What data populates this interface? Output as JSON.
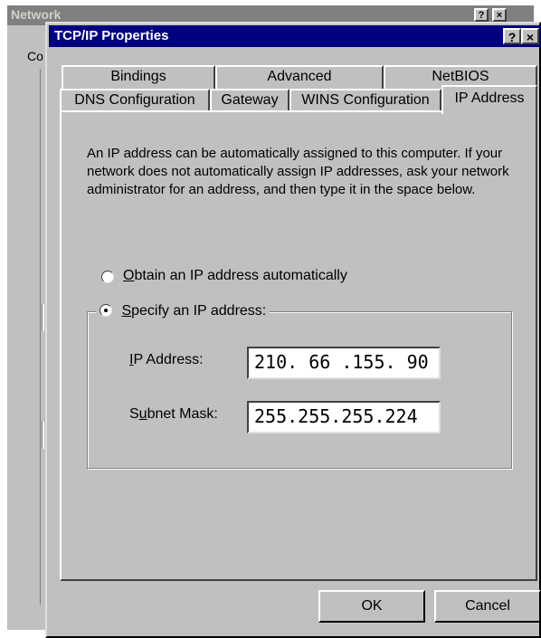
{
  "background_window": {
    "title": "Network",
    "partial_label": "Co",
    "help_button": "?",
    "close_button": "×"
  },
  "dialog": {
    "title": "TCP/IP Properties",
    "help_button": "?",
    "close_button": "×"
  },
  "tabs": {
    "row_back": [
      "Bindings",
      "Advanced",
      "NetBIOS"
    ],
    "row_front": [
      "DNS Configuration",
      "Gateway",
      "WINS Configuration",
      "IP Address"
    ],
    "active": "IP Address"
  },
  "description": "An IP address can be automatically assigned to this computer. If your network does not automatically assign IP addresses, ask your network administrator for an address, and then type it in the space below.",
  "options": {
    "obtain_auto": {
      "first": "O",
      "rest": "btain an IP address automatically",
      "selected": false
    },
    "specify": {
      "first": "S",
      "rest": "pecify an IP address:",
      "selected": true
    }
  },
  "fields": {
    "ip_label": {
      "first": "I",
      "rest": "P Address:"
    },
    "ip_value": "210. 66 .155. 90",
    "mask_label": {
      "pre": "S",
      "underlined": "u",
      "rest": "bnet Mask:"
    },
    "mask_value": "255.255.255.224"
  },
  "buttons": {
    "ok": "OK",
    "cancel": "Cancel"
  }
}
